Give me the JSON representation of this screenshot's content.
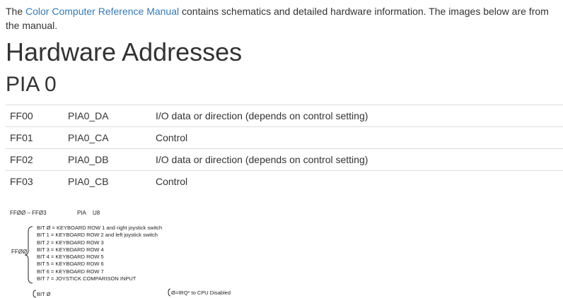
{
  "intro": {
    "prefix": "The ",
    "link": "Color Computer Reference Manual",
    "suffix": " contains schematics and detailed hardware information. The images below are from the manual."
  },
  "page_title": "Hardware Addresses",
  "section_title": "PIA 0",
  "table": {
    "rows": [
      {
        "address": "FF00",
        "name": "PIA0_DA",
        "description": "I/O data or direction (depends on control setting)"
      },
      {
        "address": "FF01",
        "name": "PIA0_CA",
        "description": "Control"
      },
      {
        "address": "FF02",
        "name": "PIA0_DB",
        "description": "I/O data or direction (depends on control setting)"
      },
      {
        "address": "FF03",
        "name": "PIA0_CB",
        "description": "Control"
      }
    ]
  },
  "figure": {
    "range": "FFØØ – FFØ3",
    "chip": "PIA",
    "chip_id": "U8",
    "register": "FFØØ",
    "bits": [
      "BIT Ø = KEYBOARD ROW 1 and right joystick switch",
      "BIT 1 = KEYBOARD ROW 2 and left joystick switch",
      "BIT 2 = KEYBOARD ROW 3",
      "BIT 3 = KEYBOARD ROW 4",
      "BIT 4 = KEYBOARD ROW 5",
      "BIT 5 = KEYBOARD ROW 6",
      "BIT 6 = KEYBOARD ROW 7",
      "BIT 7 = JOYSTICK COMPARISON INPUT"
    ],
    "bits_next": "BIT Ø",
    "control_note": "Ø=IRQ* to CPU Disabled"
  }
}
